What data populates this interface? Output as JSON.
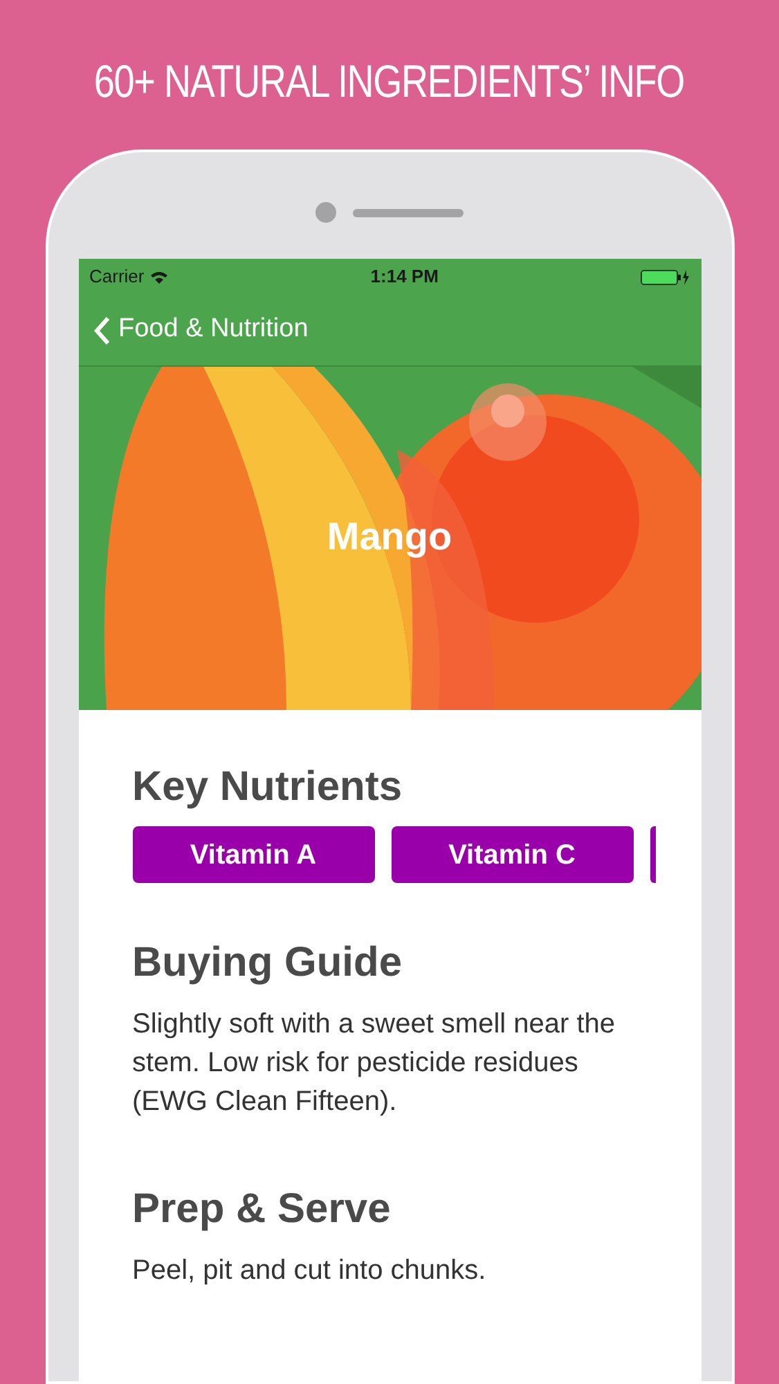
{
  "headline": "60+ NATURAL INGREDIENTS’ INFO",
  "status_bar": {
    "carrier": "Carrier",
    "time": "1:14 PM"
  },
  "nav": {
    "back_label": "Food & Nutrition"
  },
  "hero": {
    "kind": "picture",
    "title": "Mango"
  },
  "sections": [
    {
      "kind": "chips",
      "heading": "Key Nutrients",
      "chips": [
        "Vitamin A",
        "Vitamin C"
      ]
    },
    {
      "kind": "text",
      "heading": "Buying Guide",
      "body": "Slightly soft with a sweet smell near the stem. Low risk for pesticide residues (EWG Clean Fifteen)."
    },
    {
      "kind": "text",
      "heading": "Prep & Serve",
      "body": "Peel, pit and cut into chunks."
    }
  ]
}
